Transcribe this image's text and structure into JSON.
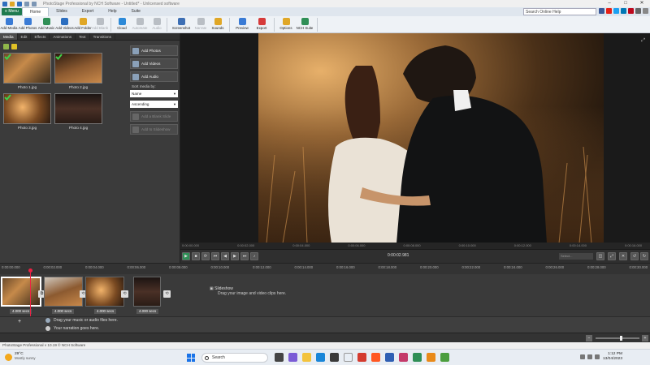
{
  "window": {
    "title": "PhotoStage Professional by NCH Software - Untitled* - Unlicensed software",
    "controls": [
      "–",
      "□",
      "✕"
    ]
  },
  "menu": {
    "menu_label": "Menu",
    "tabs": [
      "Home",
      "Slides",
      "Export",
      "Help",
      "Suite"
    ],
    "search_placeholder": "Search Online Help"
  },
  "toolbar": [
    {
      "label": "Add Media",
      "icon": "add-media-icon",
      "color": "#3a7bd5",
      "enabled": true
    },
    {
      "label": "Add Photos",
      "icon": "add-photos-icon",
      "color": "#3a7bd5",
      "enabled": true
    },
    {
      "label": "Add Music",
      "icon": "add-music-icon",
      "color": "#2f8f56",
      "enabled": true
    },
    {
      "label": "Add Videos",
      "icon": "add-videos-icon",
      "color": "#2c6fc0",
      "enabled": true
    },
    {
      "label": "Add Folder",
      "icon": "add-folder-icon",
      "color": "#e0a726",
      "enabled": true
    },
    {
      "label": "Add Blank",
      "icon": "add-blank-icon",
      "color": "#b9bec4",
      "enabled": false
    },
    {
      "label": "Cloud",
      "icon": "cloud-icon",
      "color": "#2d8ad8",
      "enabled": true
    },
    {
      "label": "Automate",
      "icon": "automate-icon",
      "color": "#b9bec4",
      "enabled": false
    },
    {
      "label": "Audio",
      "icon": "audio-icon",
      "color": "#b9bec4",
      "enabled": false
    },
    {
      "label": "Screenshot",
      "icon": "screenshot-icon",
      "color": "#3d6fb4",
      "enabled": true
    },
    {
      "label": "Narrate",
      "icon": "narrate-icon",
      "color": "#b9bec4",
      "enabled": false
    },
    {
      "label": "Sounds",
      "icon": "sounds-icon",
      "color": "#e0a726",
      "enabled": true
    },
    {
      "label": "Preview",
      "icon": "preview-icon",
      "color": "#3a7bd5",
      "enabled": true
    },
    {
      "label": "Export",
      "icon": "export-icon",
      "color": "#d63a3a",
      "enabled": true
    },
    {
      "label": "Options",
      "icon": "options-icon",
      "color": "#e0a726",
      "enabled": true
    },
    {
      "label": "NCH Suite",
      "icon": "nch-suite-icon",
      "color": "#2f8f56",
      "enabled": true
    }
  ],
  "media_panel": {
    "tabs": [
      "Media",
      "Edit",
      "Effects",
      "Animations",
      "Text",
      "Transitions"
    ],
    "active_tab": "Media",
    "items": [
      {
        "label": "Photo 1.jpg",
        "checked": true
      },
      {
        "label": "Photo 2.jpg",
        "checked": true
      },
      {
        "label": "Photo 3.jpg",
        "checked": true
      },
      {
        "label": "Photo 4.jpg",
        "checked": false
      }
    ],
    "add_photos": "Add Photos",
    "add_videos": "Add Videos",
    "add_audio": "Add Audio",
    "sort_label": "Sort media by:",
    "sort_value": "Name",
    "order_value": "Ascending",
    "add_blank_slide": "Add a Blank Slide",
    "add_to_slideshow": "Add to Slideshow"
  },
  "preview": {
    "ruler_ticks": [
      "0:00:00.000",
      "0:00:02.000",
      "0:00:04.000",
      "0:00:06.000",
      "0:00:08.000",
      "0:00:10.000",
      "0:00:12.000",
      "0:00:14.000",
      "0:00:16.000"
    ],
    "timecode": "0:00:02.981",
    "speed_label": "Select..."
  },
  "timeline": {
    "ruler_ticks": [
      "0:00:00.000",
      "0:00:02.000",
      "0:00:04.000",
      "0:00:06.000",
      "0:00:08.000",
      "0:00:10.000",
      "0:00:12.000",
      "0:00:14.000",
      "0:00:16.000",
      "0:00:18.000",
      "0:00:20.000",
      "0:00:22.000",
      "0:00:24.000",
      "0:00:26.000",
      "0:00:28.000",
      "0:00:30.000"
    ],
    "clips": [
      {
        "duration": "4.000 secs"
      },
      {
        "duration": "4.000 secs"
      },
      {
        "duration": "4.000 secs"
      },
      {
        "duration": "4.000 secs"
      }
    ],
    "slideshow_title": "Slideshow",
    "slideshow_hint": "Drag your image and video clips here.",
    "music_hint": "Drag your music or audio files here.",
    "narration_hint": "Your narration goes here."
  },
  "status": {
    "text": "PhotoStage Professional v 10.19 © NCH Software"
  },
  "taskbar": {
    "weather_temp": "29°C",
    "weather_desc": "Mostly sunny",
    "search_label": "Search",
    "time": "1:12 PM",
    "date": "13/04/2023"
  }
}
